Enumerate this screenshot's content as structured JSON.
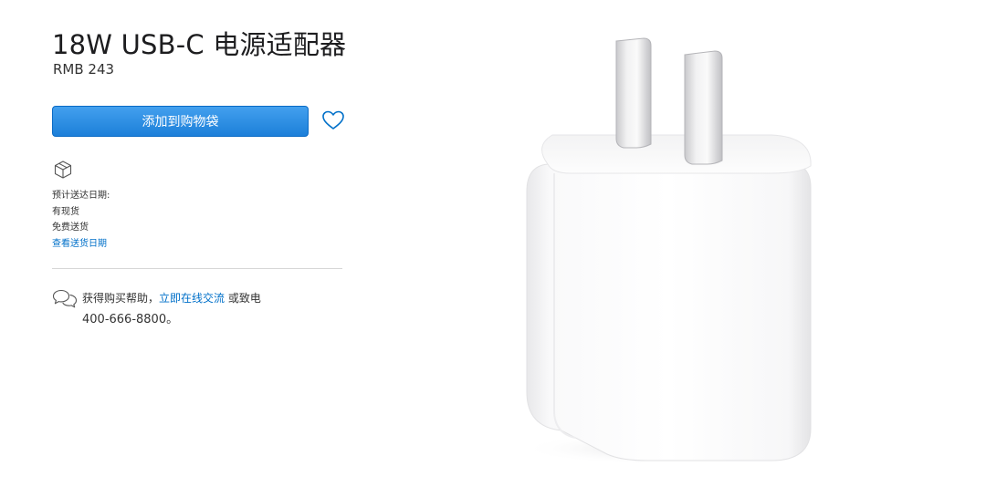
{
  "product": {
    "title": "18W USB-C 电源适配器",
    "price": "RMB 243",
    "add_to_bag_label": "添加到购物袋"
  },
  "icons": {
    "favorite": "heart-icon",
    "delivery": "box-icon",
    "chat": "chat-bubbles-icon"
  },
  "delivery": {
    "label": "预计送达日期:",
    "stock": "有现货",
    "shipping": "免费送货",
    "link": "查看送货日期"
  },
  "help": {
    "prefix": "获得购买帮助，",
    "chat_link": "立即在线交流",
    "suffix": " 或致电",
    "phone": "400-666-8800。"
  },
  "colors": {
    "accent": "#1c7fd9",
    "link": "#0070c9",
    "text": "#1d1d1f"
  }
}
